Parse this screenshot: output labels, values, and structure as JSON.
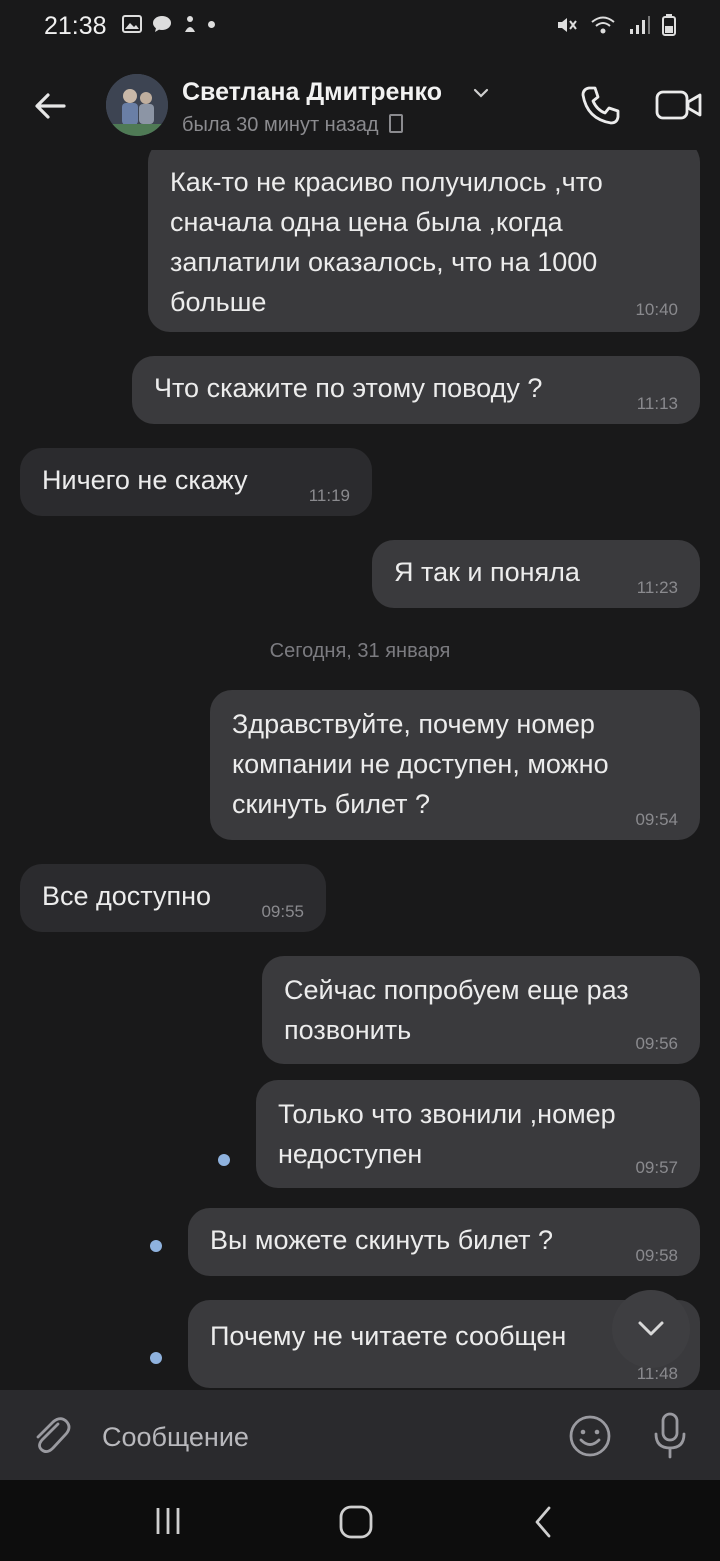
{
  "status_bar": {
    "time": "21:38"
  },
  "header": {
    "contact_name": "Светлана Дмитренко",
    "last_seen": "была 30 минут назад"
  },
  "date_separator": "Сегодня, 31 января",
  "messages": [
    {
      "direction": "outgoing",
      "text": "Как-то не красиво получилось ,что\nсначала одна цена была ,когда\nзаплатили оказалось, что на 1000\nбольше",
      "time": "10:40"
    },
    {
      "direction": "outgoing",
      "text": "Что скажите по этому поводу ?",
      "time": "11:13"
    },
    {
      "direction": "incoming",
      "text": "Ничего не скажу",
      "time": "11:19"
    },
    {
      "direction": "outgoing",
      "text": "Я так и поняла",
      "time": "11:23"
    },
    {
      "direction": "outgoing",
      "text": "Здравствуйте, почему номер\nкомпании не доступен, можно\nскинуть билет ?",
      "time": "09:54"
    },
    {
      "direction": "incoming",
      "text": "Все доступно",
      "time": "09:55"
    },
    {
      "direction": "outgoing",
      "text": "Сейчас попробуем еще раз\nпозвонить",
      "time": "09:56"
    },
    {
      "direction": "outgoing",
      "text": "Только что звонили ,номер\nнедоступен",
      "time": "09:57",
      "unread": true
    },
    {
      "direction": "outgoing",
      "text": "Вы можете скинуть билет ?",
      "time": "09:58",
      "unread": true
    },
    {
      "direction": "outgoing",
      "text": "Почему не читаете сообщен",
      "time": "11:48",
      "unread": true
    }
  ],
  "composer": {
    "placeholder": "Сообщение"
  },
  "colors": {
    "background": "#19191a",
    "bubble_outgoing": "#3a3a3d",
    "bubble_incoming": "#2b2b2e",
    "unread_dot": "#8fb2de"
  },
  "icons": {
    "header": [
      "back-arrow-icon",
      "chevron-down-icon",
      "phone-icon",
      "video-camera-icon"
    ],
    "composer": [
      "paperclip-icon",
      "emoji-icon",
      "microphone-icon"
    ],
    "navigation": [
      "recent-apps-icon",
      "home-icon",
      "back-icon"
    ]
  }
}
